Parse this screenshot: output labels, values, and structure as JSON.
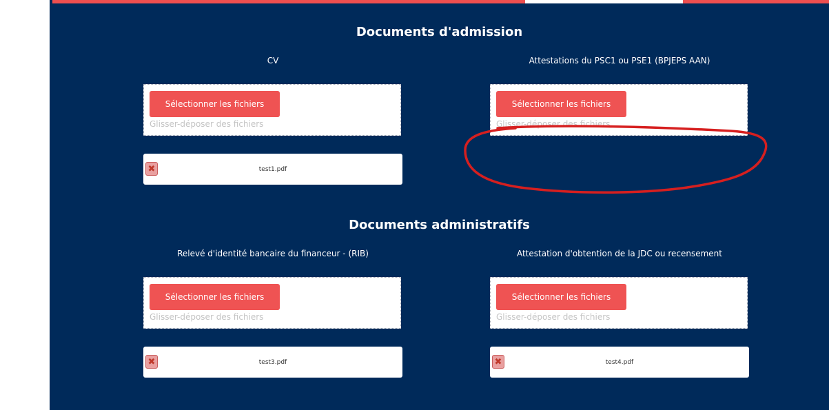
{
  "sections": [
    {
      "title": "Documents d'admission",
      "fields": [
        {
          "label": "CV",
          "button_label": "Sélectionner les fichiers",
          "drop_hint": "Glisser-déposer des fichiers",
          "file_name": "test1.pdf"
        },
        {
          "label": "Attestations du PSC1 ou PSE1 (BPJEPS AAN)",
          "button_label": "Sélectionner les fichiers",
          "drop_hint": "Glisser-déposer des fichiers"
        }
      ]
    },
    {
      "title": "Documents administratifs",
      "fields": [
        {
          "label": "Relevé d'identité bancaire du financeur - (RIB)",
          "button_label": "Sélectionner les fichiers",
          "drop_hint": "Glisser-déposer des fichiers",
          "file_name": "test3.pdf"
        },
        {
          "label": "Attestation d'obtention de la JDC ou recensement",
          "button_label": "Sélectionner les fichiers",
          "drop_hint": "Glisser-déposer des fichiers",
          "file_name": "test4.pdf"
        }
      ]
    }
  ],
  "icons": {
    "remove": "close-icon"
  },
  "colors": {
    "panel_bg": "#002a5a",
    "accent": "#ef5353",
    "annotation": "#d61f1f"
  }
}
